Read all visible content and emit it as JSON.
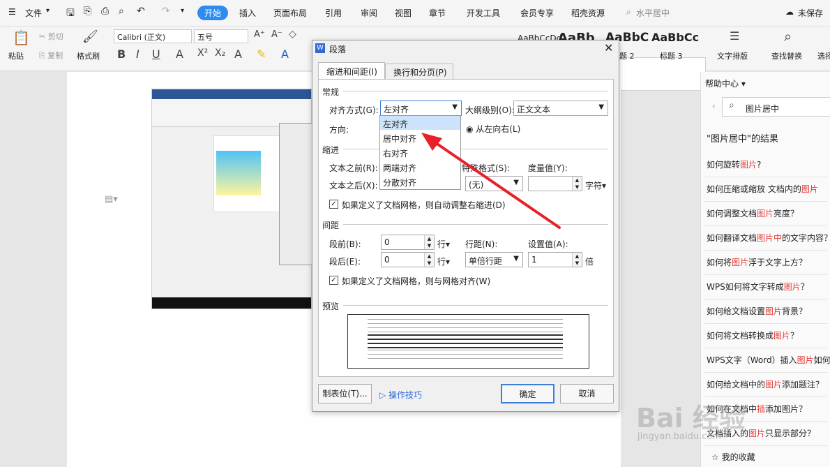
{
  "menubar": {
    "file": "文件",
    "tabs": [
      "开始",
      "插入",
      "页面布局",
      "引用",
      "审阅",
      "视图",
      "章节",
      "开发工具",
      "会员专享",
      "稻壳资源"
    ],
    "search": "水平居中",
    "unsaved": "未保存"
  },
  "ribbon": {
    "paste": "粘贴",
    "cut": "剪切",
    "copy": "复制",
    "format_painter": "格式刷",
    "font": "Calibri (正文)",
    "size": "五号",
    "styles": [
      "AaBbCcDd",
      "AaBb",
      "AaBbC",
      "AaBbCc"
    ],
    "style_labels": [
      "题 2",
      "标题 3"
    ],
    "text_layout": "文字排版",
    "find_replace": "查找替换",
    "select": "选择"
  },
  "side": {
    "header": "帮助中心",
    "search": "图片居中",
    "result_title": "\"图片居中\"的结果",
    "faq": [
      [
        "如何旋转",
        "图片",
        "?"
      ],
      [
        "如何压缩或缩放 文档内的",
        "图片",
        ""
      ],
      [
        "如何调整文档",
        "图片",
        "亮度？"
      ],
      [
        "如何翻译文档",
        "图片中",
        "的文字内容？"
      ],
      [
        "如何将",
        "图片",
        "浮于文字上方？"
      ],
      [
        "WPS如何将文字转成",
        "图片",
        "？"
      ],
      [
        "如何给文档设置",
        "图片",
        "背景？"
      ],
      [
        "如何将文档转换成",
        "图片",
        "？"
      ],
      [
        "WPS文字（Word）插入",
        "图片",
        "如何"
      ],
      [
        "如何给文档中的",
        "图片",
        "添加题注？"
      ],
      [
        "如何在文档中",
        "插",
        "添加图片？"
      ],
      [
        "文档插入的",
        "图片",
        "只显示部分？"
      ]
    ],
    "favorites": "我的收藏"
  },
  "dialog": {
    "title": "段落",
    "tabs": [
      "缩进和间距(I)",
      "换行和分页(P)"
    ],
    "general": "常规",
    "align_label": "对齐方式(G):",
    "align_value": "左对齐",
    "outline_label": "大纲级别(O):",
    "outline_value": "正文文本",
    "direction_label": "方向:",
    "direction_option": "从左向右(L)",
    "indent": "缩进",
    "before_text": "文本之前(R):",
    "after_text": "文本之后(X):",
    "special_label": "特殊格式(S):",
    "special_value": "(无)",
    "measure_label": "度量值(Y):",
    "measure_unit": "字符",
    "grid_indent": "如果定义了文档网格，则自动调整右缩进(D)",
    "spacing": "间距",
    "space_before": "段前(B):",
    "space_before_val": "0",
    "space_after": "段后(E):",
    "space_after_val": "0",
    "unit_line": "行",
    "line_spacing_label": "行距(N):",
    "line_spacing_val": "单倍行距",
    "setting_label": "设置值(A):",
    "setting_val": "1",
    "unit_times": "倍",
    "grid_align": "如果定义了文档网格，则与网格对齐(W)",
    "preview": "预览",
    "tab_button": "制表位(T)...",
    "tips": "操作技巧",
    "ok": "确定",
    "cancel": "取消",
    "dropdown": [
      "左对齐",
      "居中对齐",
      "右对齐",
      "两端对齐",
      "分散对齐"
    ]
  },
  "watermark": "Bai 经验",
  "watermark_url": "jingyan.baidu.com"
}
